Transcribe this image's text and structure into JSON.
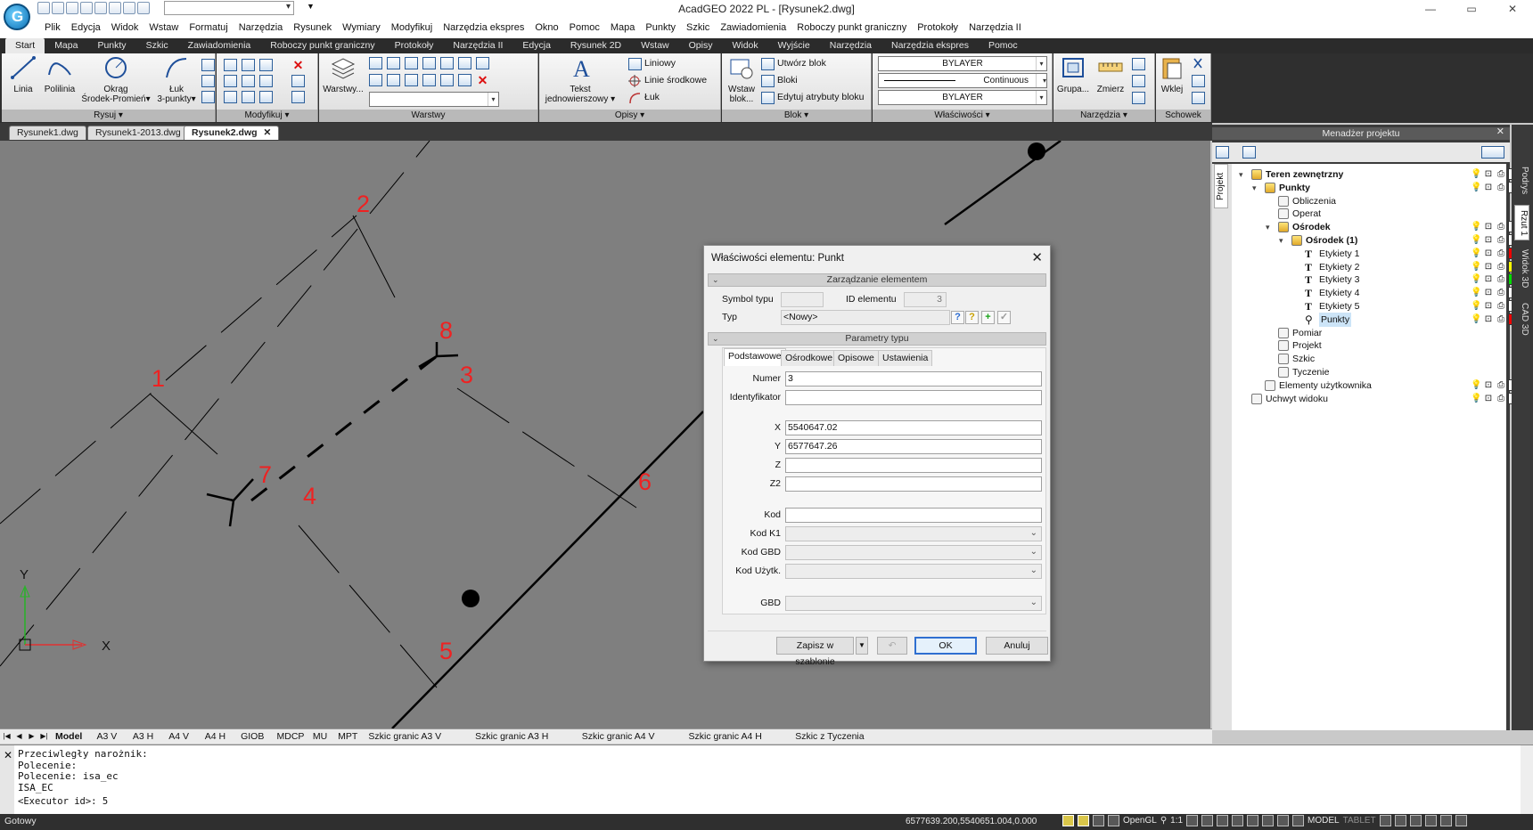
{
  "window": {
    "title": "AcadGEO 2022 PL - [Rysunek2.dwg]",
    "controls": [
      "—",
      "▭",
      "✕"
    ]
  },
  "menu": [
    "Plik",
    "Edycja",
    "Widok",
    "Wstaw",
    "Formatuj",
    "Narzędzia",
    "Rysunek",
    "Wymiary",
    "Modyfikuj",
    "Narzędzia ekspres",
    "Okno",
    "Pomoc",
    "Mapa",
    "Punkty",
    "Szkic",
    "Zawiadomienia",
    "Roboczy punkt graniczny",
    "Protokoły",
    "Narzędzia II"
  ],
  "ribbon_tabs": [
    "Start",
    "Mapa",
    "Punkty",
    "Szkic",
    "Zawiadomienia",
    "Roboczy punkt graniczny",
    "Protokoły",
    "Narzędzia II",
    "Edycja",
    "Rysunek 2D",
    "Wstaw",
    "Opisy",
    "Widok",
    "Wyjście",
    "Narzędzia",
    "Narzędzia ekspres",
    "Pomoc"
  ],
  "ribbon": {
    "draw": {
      "title": "Rysuj ▾",
      "line": "Linia",
      "polyline": "Polilinia",
      "circle": "Okrąg\nŚrodek-Promień▾",
      "arc": "Łuk\n3-punkty▾"
    },
    "modify": {
      "title": "Modyfikuj ▾"
    },
    "layers": {
      "title": "Warstwy",
      "button": "Warstwy..."
    },
    "text": {
      "title": "Opisy ▾",
      "big": "Tekst\njednowierszowy ▾",
      "linear": "Liniowy",
      "center_lines": "Linie środkowe",
      "arc": "Łuk"
    },
    "block": {
      "title": "Blok ▾",
      "insert": "Wstaw\nblok...",
      "create": "Utwórz blok",
      "blocks": "Bloki",
      "edit_attr": "Edytuj atrybuty bloku"
    },
    "properties": {
      "title": "Właściwości ▾",
      "color": "BYLAYER",
      "linetype": "Continuous",
      "lineweight": "BYLAYER"
    },
    "tools": {
      "title": "Narzędzia ▾",
      "group": "Grupa...",
      "measure": "Zmierz"
    },
    "clipboard": {
      "title": "Schowek",
      "paste": "Wklej"
    }
  },
  "doc_tabs": [
    {
      "label": "Rysunek1.dwg",
      "active": false
    },
    {
      "label": "Rysunek1-2013.dwg",
      "active": false
    },
    {
      "label": "Rysunek2.dwg",
      "active": true
    }
  ],
  "drawing": {
    "point_labels": [
      "1",
      "2",
      "3",
      "4",
      "5",
      "6",
      "7",
      "8"
    ],
    "ucs": {
      "y": "Y",
      "x": "X"
    }
  },
  "dialog": {
    "title": "Właściwości elementu: Punkt",
    "section1": "Zarządzanie elementem",
    "symbol_label": "Symbol typu",
    "id_label": "ID elementu",
    "id_value": "3",
    "type_label": "Typ",
    "type_value": "<Nowy>",
    "section2": "Parametry typu",
    "tabs": [
      "Podstawowe",
      "Ośrodkowe",
      "Opisowe",
      "Ustawienia"
    ],
    "fields": {
      "numer": {
        "label": "Numer",
        "value": "3"
      },
      "identyfikator": {
        "label": "Identyfikator",
        "value": ""
      },
      "x": {
        "label": "X",
        "value": "5540647.02"
      },
      "y": {
        "label": "Y",
        "value": "6577647.26"
      },
      "z": {
        "label": "Z",
        "value": ""
      },
      "z2": {
        "label": "Z2",
        "value": ""
      },
      "kod": {
        "label": "Kod",
        "value": ""
      },
      "kod_k1": {
        "label": "Kod K1"
      },
      "kod_gbd": {
        "label": "Kod GBD"
      },
      "kod_uzytk": {
        "label": "Kod Użytk."
      },
      "gbd": {
        "label": "GBD"
      }
    },
    "buttons": {
      "save_template": "Zapisz w szablonie",
      "ok": "OK",
      "cancel": "Anuluj"
    }
  },
  "project": {
    "title": "Menadżer projektu",
    "left_tab": "Projekt",
    "tree": [
      {
        "label": "Teren zewnętrzny",
        "level": 0,
        "bold": true,
        "exp": "▾",
        "swatch": "#ffffff",
        "icons": true,
        "icon": "globe-icon"
      },
      {
        "label": "Punkty",
        "level": 1,
        "bold": true,
        "exp": "▾",
        "swatch": "#ffffff",
        "icons": true,
        "icon": "points-icon"
      },
      {
        "label": "Obliczenia",
        "level": 2,
        "bold": false,
        "exp": "",
        "icons": false,
        "icon": "calc-icon"
      },
      {
        "label": "Operat",
        "level": 2,
        "bold": false,
        "exp": "",
        "icons": false,
        "icon": "doc-icon"
      },
      {
        "label": "Ośrodek",
        "level": 2,
        "bold": true,
        "exp": "▾",
        "swatch": "#ffffff",
        "icons": true,
        "icon": "house-icon"
      },
      {
        "label": "Ośrodek (1)",
        "level": 3,
        "bold": true,
        "exp": "▾",
        "swatch": "#ffffff",
        "icons": true,
        "icon": "shield-icon"
      },
      {
        "label": "Etykiety 1",
        "level": 4,
        "bold": false,
        "exp": "",
        "swatch": "#ee0000",
        "icons": true,
        "icon": "text-icon"
      },
      {
        "label": "Etykiety 2",
        "level": 4,
        "bold": false,
        "exp": "",
        "swatch": "#ffff00",
        "icons": true,
        "icon": "text-icon"
      },
      {
        "label": "Etykiety 3",
        "level": 4,
        "bold": false,
        "exp": "",
        "swatch": "#00dd00",
        "icons": true,
        "icon": "text-icon"
      },
      {
        "label": "Etykiety 4",
        "level": 4,
        "bold": false,
        "exp": "",
        "swatch": "#ffffff",
        "icons": true,
        "icon": "text-icon"
      },
      {
        "label": "Etykiety 5",
        "level": 4,
        "bold": false,
        "exp": "",
        "swatch": "#ffffff",
        "icons": true,
        "icon": "text-icon"
      },
      {
        "label": "Punkty",
        "level": 4,
        "bold": false,
        "exp": "",
        "swatch": "#ee0000",
        "icons": true,
        "selected": true,
        "icon": "pin-icon"
      },
      {
        "label": "Pomiar",
        "level": 2,
        "bold": false,
        "exp": "",
        "icons": false,
        "icon": "tripod-icon"
      },
      {
        "label": "Projekt",
        "level": 2,
        "bold": false,
        "exp": "",
        "icons": false,
        "icon": "doc-icon"
      },
      {
        "label": "Szkic",
        "level": 2,
        "bold": false,
        "exp": "",
        "icons": false,
        "icon": "doc-icon"
      },
      {
        "label": "Tyczenie",
        "level": 2,
        "bold": false,
        "exp": "",
        "icons": false,
        "icon": "doc-icon"
      },
      {
        "label": "Elementy użytkownika",
        "level": 1,
        "bold": false,
        "exp": "",
        "swatch": "#ffffff",
        "icons": true,
        "icon": "user-elements-icon"
      },
      {
        "label": "Uchwyt widoku",
        "level": 0,
        "bold": false,
        "exp": "",
        "swatch": "#ffffff",
        "icons": true,
        "icon": "view-handle-icon"
      }
    ],
    "side_tabs": [
      "Podrys",
      "Rzut 1",
      "Widok 3D",
      "CAD 3D"
    ]
  },
  "layout_tabs": [
    "Model",
    "A3 V",
    "A3 H",
    "A4 V",
    "A4 H",
    "GIOB",
    "MDCP",
    "MU",
    "MPT",
    "Szkic granic A3 V",
    "Szkic granic A3 H",
    "Szkic granic A4 V",
    "Szkic granic A4 H",
    "Szkic z Tyczenia"
  ],
  "command": {
    "lines": [
      "Przeciwległy narożnik:",
      "Polecenie:",
      "Polecenie: isa_ec",
      "ISA_EC"
    ],
    "input": "<Executor id>: 5"
  },
  "status": {
    "text": "Gotowy",
    "coords": "6577639.200,5540651.004,0.000",
    "opengl": "OpenGL",
    "scale": "1:1",
    "model": "MODEL",
    "tablet": "TABLET"
  }
}
